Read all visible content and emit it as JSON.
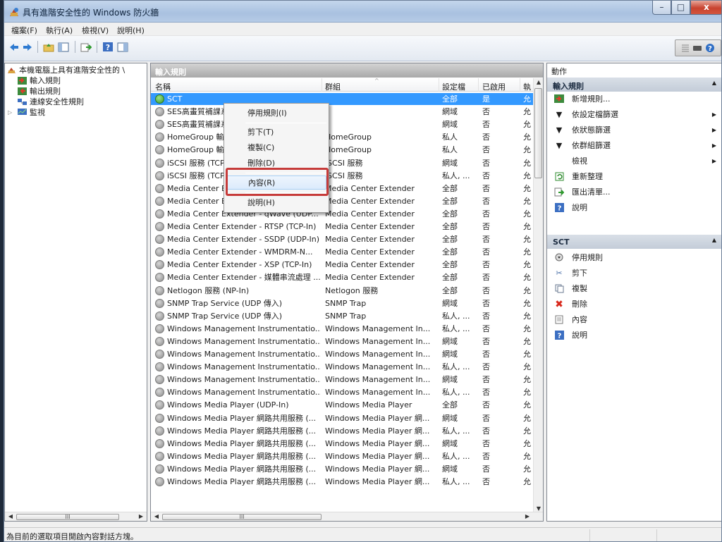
{
  "window": {
    "title": "具有進階安全性的 Windows 防火牆",
    "min_label": "–",
    "max_label": "□",
    "close_label": "x"
  },
  "menu": [
    "檔案(F)",
    "執行(A)",
    "檢視(V)",
    "說明(H)"
  ],
  "tree": {
    "root": "本機電腦上具有進階安全性的 \\",
    "items": [
      "輸入規則",
      "輸出規則",
      "連線安全性規則",
      "監視"
    ]
  },
  "middle": {
    "header": "輸入規則",
    "columns": [
      "名稱",
      "群組",
      "設定檔",
      "已啟用",
      "執"
    ],
    "rows": [
      {
        "name": "SCT",
        "group": "",
        "profile": "全部",
        "enabled": "是",
        "action": "允"
      },
      {
        "name": "SES高畫質補課系",
        "group": "",
        "profile": "網域",
        "enabled": "否",
        "action": "允"
      },
      {
        "name": "SES高畫質補課系",
        "group": "",
        "profile": "網域",
        "enabled": "否",
        "action": "允"
      },
      {
        "name": "HomeGroup 輸入",
        "group": "HomeGroup",
        "profile": "私人",
        "enabled": "否",
        "action": "允"
      },
      {
        "name": "HomeGroup 輸入",
        "group": "HomeGroup",
        "profile": "私人",
        "enabled": "否",
        "action": "允"
      },
      {
        "name": "iSCSI 服務 (TCP-",
        "group": "iSCSI 服務",
        "profile": "網域",
        "enabled": "否",
        "action": "允"
      },
      {
        "name": "iSCSI 服務 (TCP-",
        "group": "iSCSI 服務",
        "profile": "私人, ...",
        "enabled": "否",
        "action": "允"
      },
      {
        "name": "Media Center Ex",
        "group": "Media Center Extender",
        "profile": "全部",
        "enabled": "否",
        "action": "允"
      },
      {
        "name": "Media Center Extender - qWave (TCP-...",
        "group": "Media Center Extender",
        "profile": "全部",
        "enabled": "否",
        "action": "允"
      },
      {
        "name": "Media Center Extender - qWave (UDP...",
        "group": "Media Center Extender",
        "profile": "全部",
        "enabled": "否",
        "action": "允"
      },
      {
        "name": "Media Center Extender - RTSP (TCP-In)",
        "group": "Media Center Extender",
        "profile": "全部",
        "enabled": "否",
        "action": "允"
      },
      {
        "name": "Media Center Extender - SSDP (UDP-In)",
        "group": "Media Center Extender",
        "profile": "全部",
        "enabled": "否",
        "action": "允"
      },
      {
        "name": "Media Center Extender - WMDRM-N...",
        "group": "Media Center Extender",
        "profile": "全部",
        "enabled": "否",
        "action": "允"
      },
      {
        "name": "Media Center Extender - XSP (TCP-In)",
        "group": "Media Center Extender",
        "profile": "全部",
        "enabled": "否",
        "action": "允"
      },
      {
        "name": "Media Center Extender - 媒體串流處理 ...",
        "group": "Media Center Extender",
        "profile": "全部",
        "enabled": "否",
        "action": "允"
      },
      {
        "name": "Netlogon 服務 (NP-In)",
        "group": "Netlogon 服務",
        "profile": "全部",
        "enabled": "否",
        "action": "允"
      },
      {
        "name": "SNMP Trap Service (UDP 傳入)",
        "group": "SNMP Trap",
        "profile": "網域",
        "enabled": "否",
        "action": "允"
      },
      {
        "name": "SNMP Trap Service (UDP 傳入)",
        "group": "SNMP Trap",
        "profile": "私人, ...",
        "enabled": "否",
        "action": "允"
      },
      {
        "name": "Windows Management Instrumentatio...",
        "group": "Windows Management In...",
        "profile": "私人, ...",
        "enabled": "否",
        "action": "允"
      },
      {
        "name": "Windows Management Instrumentatio...",
        "group": "Windows Management In...",
        "profile": "網域",
        "enabled": "否",
        "action": "允"
      },
      {
        "name": "Windows Management Instrumentatio...",
        "group": "Windows Management In...",
        "profile": "網域",
        "enabled": "否",
        "action": "允"
      },
      {
        "name": "Windows Management Instrumentatio...",
        "group": "Windows Management In...",
        "profile": "私人, ...",
        "enabled": "否",
        "action": "允"
      },
      {
        "name": "Windows Management Instrumentatio...",
        "group": "Windows Management In...",
        "profile": "網域",
        "enabled": "否",
        "action": "允"
      },
      {
        "name": "Windows Management Instrumentatio...",
        "group": "Windows Management In...",
        "profile": "私人, ...",
        "enabled": "否",
        "action": "允"
      },
      {
        "name": "Windows Media Player (UDP-In)",
        "group": "Windows Media Player",
        "profile": "全部",
        "enabled": "否",
        "action": "允"
      },
      {
        "name": "Windows Media Player 網路共用服務 (...",
        "group": "Windows Media Player 網...",
        "profile": "網域",
        "enabled": "否",
        "action": "允"
      },
      {
        "name": "Windows Media Player 網路共用服務 (...",
        "group": "Windows Media Player 網...",
        "profile": "私人, ...",
        "enabled": "否",
        "action": "允"
      },
      {
        "name": "Windows Media Player 網路共用服務 (...",
        "group": "Windows Media Player 網...",
        "profile": "網域",
        "enabled": "否",
        "action": "允"
      },
      {
        "name": "Windows Media Player 網路共用服務 (...",
        "group": "Windows Media Player 網...",
        "profile": "私人, ...",
        "enabled": "否",
        "action": "允"
      },
      {
        "name": "Windows Media Player 網路共用服務 (...",
        "group": "Windows Media Player 網...",
        "profile": "網域",
        "enabled": "否",
        "action": "允"
      },
      {
        "name": "Windows Media Player 網路共用服務 (...",
        "group": "Windows Media Player 網...",
        "profile": "私人, ...",
        "enabled": "否",
        "action": "允"
      }
    ]
  },
  "context_menu": [
    "停用規則(I)",
    "剪下(T)",
    "複製(C)",
    "刪除(D)",
    "內容(R)",
    "說明(H)"
  ],
  "actions": {
    "header": "動作",
    "section1": "輸入規則",
    "items1": [
      "新增規則...",
      "依設定檔篩選",
      "依狀態篩選",
      "依群組篩選",
      "檢視",
      "重新整理",
      "匯出清單...",
      "說明"
    ],
    "section2": "SCT",
    "items2": [
      "停用規則",
      "剪下",
      "複製",
      "刪除",
      "內容",
      "說明"
    ]
  },
  "status": "為目前的選取項目開啟內容對話方塊。",
  "colors": {
    "selection": "#3399ff",
    "highlight_box": "#c63b3a"
  }
}
